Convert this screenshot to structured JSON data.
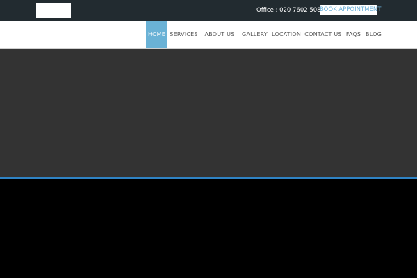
{
  "topbar": {
    "office_text": "Office : 020 7602 5089",
    "book_label": "BOOK APPOINTMENT"
  },
  "nav": {
    "items": [
      {
        "label": "HOME",
        "active": true
      },
      {
        "label": "SERVICES"
      },
      {
        "label": "ABOUT US"
      },
      {
        "label": "GALLERY"
      },
      {
        "label": "LOCATION"
      },
      {
        "label": "CONTACT US"
      },
      {
        "label": "FAQS"
      },
      {
        "label": "BLOG"
      }
    ]
  },
  "colors": {
    "topbar_bg": "#222b30",
    "accent": "#6ab2d6",
    "hero_bg": "#333333",
    "accent_line": "#2f83c4"
  }
}
